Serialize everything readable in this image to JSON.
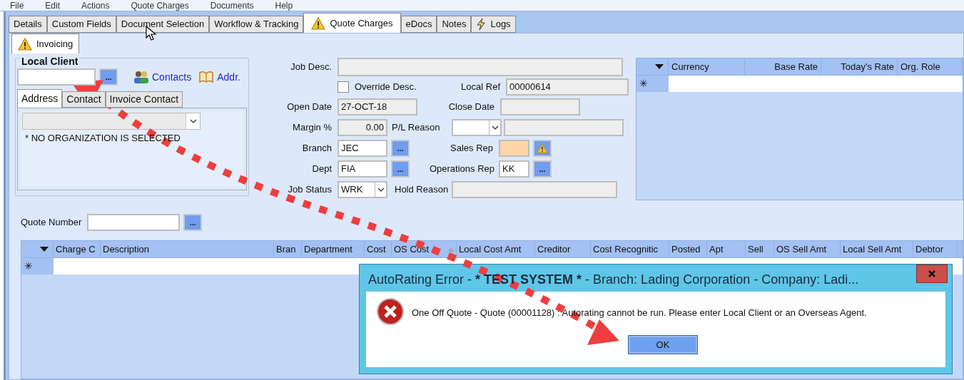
{
  "menu": [
    "File",
    "Edit",
    "Actions",
    "Quote Charges",
    "Documents",
    "Help"
  ],
  "tabs": [
    {
      "label": "Details",
      "selected": false,
      "kind": "plain"
    },
    {
      "label": "Custom Fields",
      "selected": false,
      "kind": "plain"
    },
    {
      "label": "Document Selection",
      "selected": false,
      "kind": "plain"
    },
    {
      "label": "Workflow & Tracking",
      "selected": false,
      "kind": "plain"
    },
    {
      "label": "Quote Charges",
      "selected": true,
      "kind": "warning"
    },
    {
      "label": "eDocs",
      "selected": false,
      "kind": "plain"
    },
    {
      "label": "Notes",
      "selected": false,
      "kind": "plain"
    },
    {
      "label": "Logs",
      "selected": false,
      "kind": "bolt"
    }
  ],
  "subtabs": [
    {
      "label": "Invoicing",
      "selected": true,
      "kind": "warning"
    }
  ],
  "local_client": {
    "title": "Local Client",
    "lookup": "...",
    "links": [
      {
        "label": "Contacts",
        "kind": "people"
      },
      {
        "label": "Addr.",
        "kind": "book"
      }
    ],
    "tabs": [
      {
        "label": "Address",
        "selected": true
      },
      {
        "label": "Contact",
        "selected": false
      },
      {
        "label": "Invoice Contact",
        "selected": false
      }
    ],
    "note": "* NO ORGANIZATION IS SELECTED"
  },
  "job": {
    "job_desc": {
      "label": "Job Desc."
    },
    "override_desc": {
      "label": "Override Desc.",
      "checked": false
    },
    "local_ref": {
      "label": "Local Ref",
      "value": "00000614"
    },
    "open_date": {
      "label": "Open Date",
      "value": "27-OCT-18"
    },
    "close_date": {
      "label": "Close Date"
    },
    "margin": {
      "label": "Margin %",
      "value": "0.00"
    },
    "pl_reason": {
      "label": "P/L Reason"
    },
    "branch": {
      "label": "Branch",
      "value": "JEC",
      "lookup": "..."
    },
    "sales_rep": {
      "label": "Sales Rep",
      "required": true
    },
    "dept": {
      "label": "Dept",
      "value": "FIA",
      "lookup": "..."
    },
    "operations_rep": {
      "label": "Operations Rep",
      "value": "KK",
      "lookup": "..."
    },
    "job_status": {
      "label": "Job Status",
      "value": "WRK"
    },
    "hold_reason": {
      "label": "Hold Reason"
    }
  },
  "currency_grid": {
    "new_row_marker": "✳",
    "columns": [
      "Currency",
      "Base Rate",
      "Today's Rate",
      "Org. Role"
    ]
  },
  "quote_number": {
    "label": "Quote Number",
    "lookup": "..."
  },
  "charges_grid": {
    "new_row_marker": "✳",
    "columns": [
      {
        "label": "Charge C",
        "sorted": false
      },
      {
        "label": "Description",
        "sorted": false
      },
      {
        "label": "Bran",
        "sorted": false
      },
      {
        "label": "Department",
        "sorted": false
      },
      {
        "label": "Cost",
        "sorted": false
      },
      {
        "label": "OS Cost",
        "sorted": true
      },
      {
        "label": "Local Cost Amt",
        "sorted": false
      },
      {
        "label": "Creditor",
        "sorted": false
      },
      {
        "label": "Cost Recognitic",
        "sorted": false
      },
      {
        "label": "Posted",
        "sorted": false
      },
      {
        "label": "Apt",
        "sorted": false
      },
      {
        "label": "Sell",
        "sorted": false
      },
      {
        "label": "OS Sell Amt",
        "sorted": false
      },
      {
        "label": "Local Sell Amt",
        "sorted": false
      },
      {
        "label": "Debtor",
        "sorted": false
      }
    ]
  },
  "dialog": {
    "title": "AutoRating Error - *** TEST SYSTEM *** - Branch: Lading Corporation - Company: Ladi...",
    "message": "One Off Quote - Quote (00001128) : Autorating cannot be run. Please enter Local Client or an Overseas Agent.",
    "buttons": [
      "OK"
    ]
  }
}
